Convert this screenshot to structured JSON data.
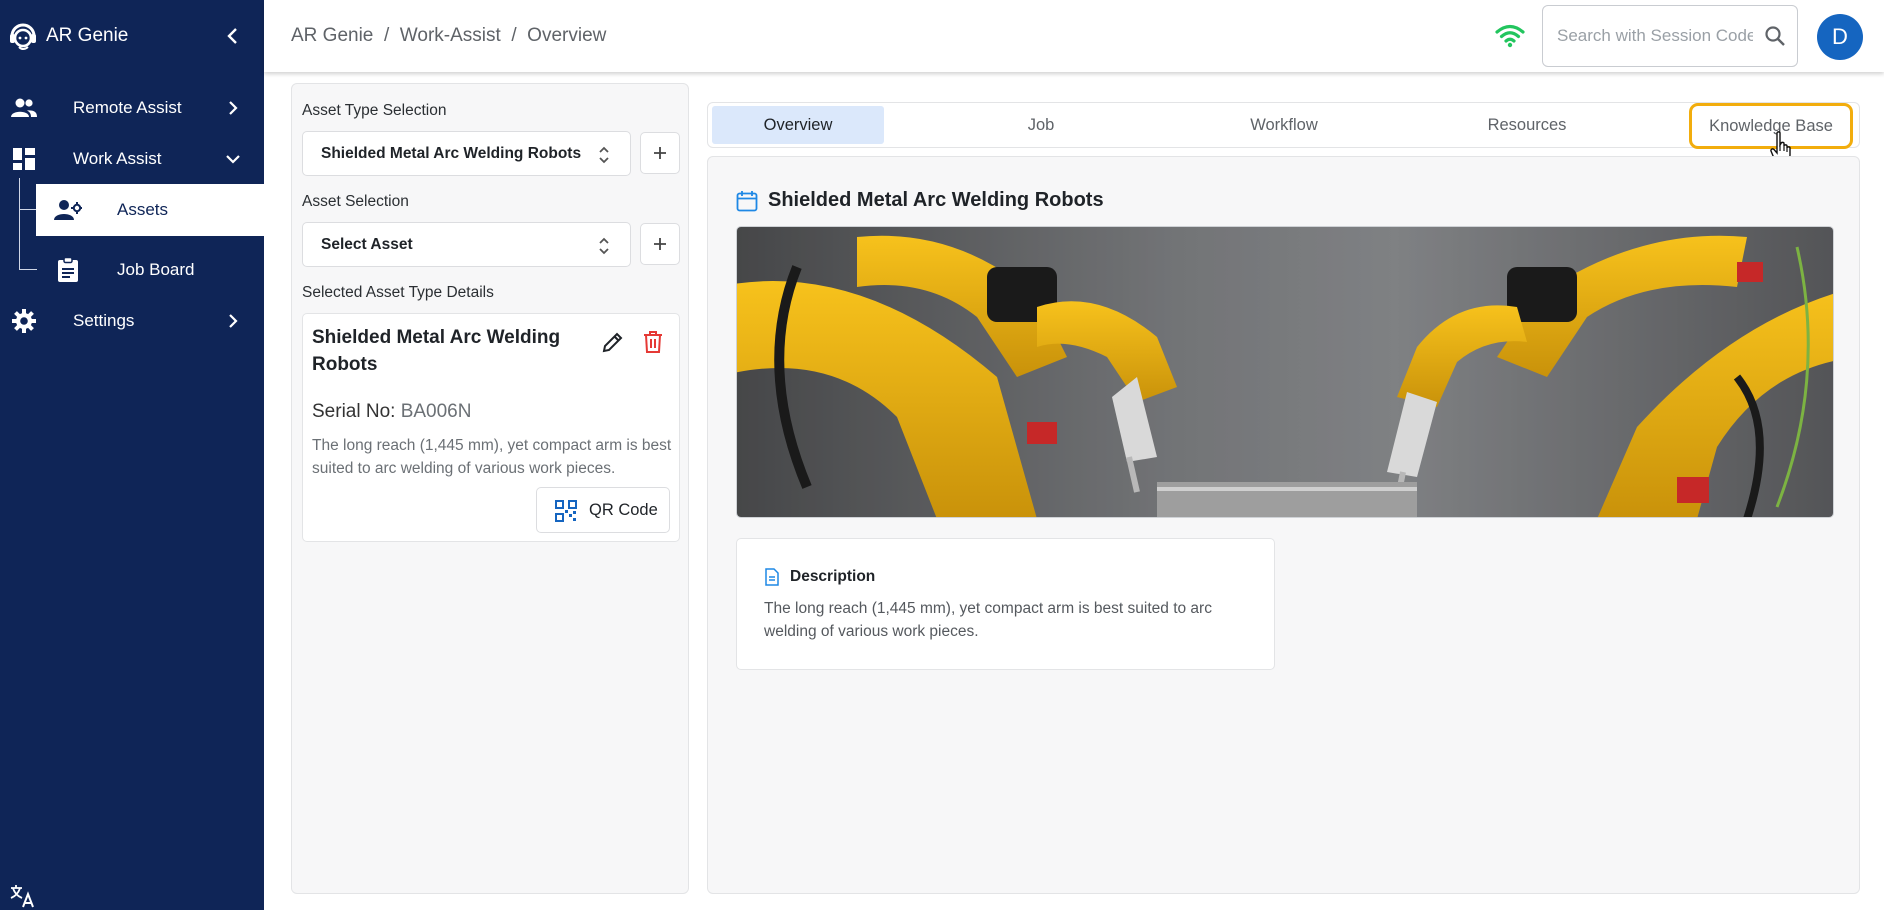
{
  "app": {
    "name": "AR Genie"
  },
  "sidebar": {
    "items": [
      {
        "label": "Remote Assist",
        "icon": "people-icon"
      },
      {
        "label": "Work Assist",
        "icon": "dashboard-icon"
      },
      {
        "label": "Settings",
        "icon": "gear-icon"
      }
    ],
    "sub_items": [
      {
        "label": "Assets",
        "icon": "assets-icon",
        "active": true
      },
      {
        "label": "Job Board",
        "icon": "clipboard-icon"
      }
    ],
    "language_icon": "translate-icon"
  },
  "header": {
    "breadcrumb": [
      "AR Genie",
      "Work-Assist",
      "Overview"
    ],
    "breadcrumb_separator": "/",
    "search": {
      "placeholder": "Search with Session Code",
      "value": ""
    },
    "avatar_initial": "D",
    "connection_status_color": "#22c55e"
  },
  "left_panel": {
    "asset_type_label": "Asset Type Selection",
    "asset_type_value": "Shielded Metal Arc Welding Robots",
    "asset_label": "Asset Selection",
    "asset_value": "Select Asset",
    "details_label": "Selected Asset Type Details",
    "details": {
      "title": "Shielded Metal Arc Welding Robots",
      "serial_label": "Serial No:",
      "serial_value": "BA006N",
      "description": "The long reach (1,445 mm), yet compact arm is best suited to arc welding of various work pieces.",
      "qr_label": "QR Code"
    }
  },
  "tabs": [
    {
      "label": "Overview",
      "active": true
    },
    {
      "label": "Job"
    },
    {
      "label": "Workflow"
    },
    {
      "label": "Resources"
    },
    {
      "label": "Knowledge Base",
      "focused": true
    }
  ],
  "overview": {
    "title": "Shielded Metal Arc Welding Robots",
    "image_alt": "Yellow welding robot arms",
    "description_heading": "Description",
    "description": "The long reach (1,445 mm), yet compact arm is best suited to arc welding of various work pieces."
  },
  "colors": {
    "sidebar_bg": "#0f2557",
    "accent_blue": "#1565c0",
    "active_tab_bg": "#dbe8fb",
    "focus_ring": "#f2ad0d",
    "delete_red": "#e53935"
  }
}
